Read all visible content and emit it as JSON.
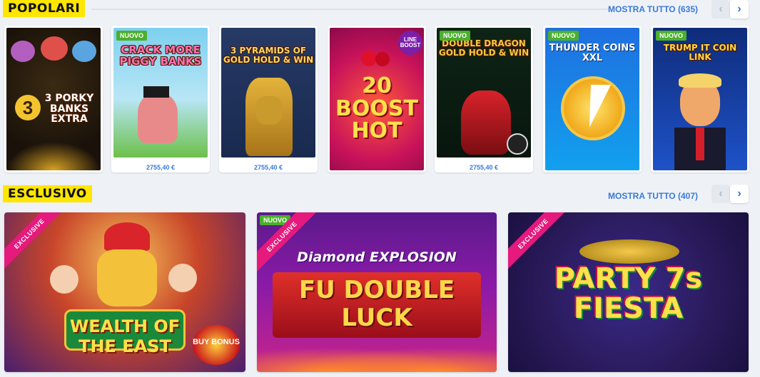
{
  "popular": {
    "title": "POPOLARI",
    "show_all": "MOSTRA TUTTO (635)",
    "games": [
      {
        "name": "3 PORKY BANKS EXTRA",
        "badge": "",
        "jackpot": ""
      },
      {
        "name": "CRACK MORE PIGGY BANKS",
        "badge": "NUOVO",
        "jackpot": "2755,40 €"
      },
      {
        "name": "3 PYRAMIDS OF GOLD HOLD & WIN",
        "badge": "",
        "jackpot": "2755,40 €"
      },
      {
        "name": "20 BOOST HOT",
        "badge": "",
        "jackpot": "",
        "corner": "LINE BOOST"
      },
      {
        "name": "DOUBLE DRAGON GOLD HOLD & WIN",
        "badge": "NUOVO",
        "jackpot": "2755,40 €"
      },
      {
        "name": "THUNDER COINS XXL",
        "badge": "NUOVO",
        "jackpot": ""
      },
      {
        "name": "TRUMP IT COIN LINK",
        "badge": "NUOVO",
        "jackpot": ""
      }
    ]
  },
  "exclusive": {
    "title": "ESCLUSIVO",
    "show_all": "MOSTRA TUTTO (407)",
    "games": [
      {
        "name": "WEALTH OF THE EAST",
        "ribbon": "EXCLUSIVE",
        "badge": "",
        "extra": "BUY BONUS"
      },
      {
        "name_top": "Diamond EXPLOSION",
        "name": "FU DOUBLE LUCK",
        "ribbon": "EXCLUSIVE",
        "badge": "NUOVO"
      },
      {
        "name": "PARTY 7s FIESTA",
        "ribbon": "EXCLUSIVE",
        "badge": ""
      }
    ]
  },
  "icons": {
    "prev": "chevron-left-icon",
    "next": "chevron-right-icon"
  },
  "colors": {
    "accent": "#3a7bd5",
    "title_bg": "#ffe600",
    "new_badge": "#4caf2e",
    "exclusive_ribbon": "#e6197d"
  }
}
